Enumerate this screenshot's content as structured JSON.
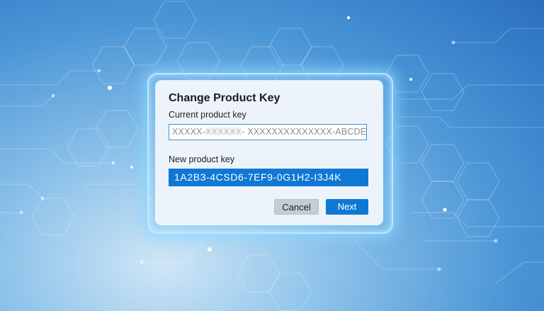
{
  "dialog": {
    "title": "Change Product Key",
    "current_label": "Current product key",
    "current_value_prefix": "XXXXX-",
    "current_value_obscured": "XXXXXX",
    "current_value_suffix": "- XXXXXXXXXXXXXX-ABCDE",
    "new_label": "New product key",
    "new_value": "1A2B3-4CSD6-7EF9-0G1H2-I3J4K",
    "cancel_label": "Cancel",
    "next_label": "Next"
  },
  "colors": {
    "accent": "#0f78d4",
    "dialog_bg": "#edf3fa",
    "cancel_bg": "#c5ccd3",
    "glow": "#8cd7ff"
  }
}
